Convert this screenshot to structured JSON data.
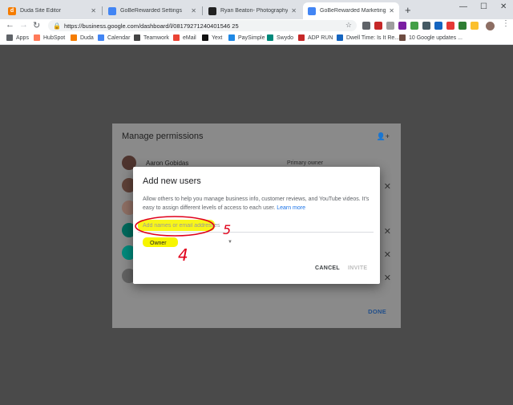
{
  "browser": {
    "tabs": [
      {
        "title": "Duda Site Editor",
        "color": "#f57c00",
        "active": false
      },
      {
        "title": "GoBeRewarded Settings",
        "color": "#4285f4",
        "active": false
      },
      {
        "title": "Ryan Beaton- Photography - Tai",
        "color": "#222222",
        "active": false
      },
      {
        "title": "GoBeRewarded Marketing Agenc",
        "color": "#4285f4",
        "active": true
      }
    ],
    "url": "https://business.google.com/dashboard/l/08179271240401546 25"
  },
  "bookmarks": [
    {
      "label": "Apps",
      "color": "#5f6368"
    },
    {
      "label": "HubSpot",
      "color": "#ff7a59"
    },
    {
      "label": "Duda",
      "color": "#f57c00"
    },
    {
      "label": "Calendar",
      "color": "#4285f4"
    },
    {
      "label": "Teamwork",
      "color": "#444444"
    },
    {
      "label": "eMail",
      "color": "#ea4335"
    },
    {
      "label": "Yext",
      "color": "#111111"
    },
    {
      "label": "PaySimple",
      "color": "#1e88e5"
    },
    {
      "label": "Swydo",
      "color": "#00897b"
    },
    {
      "label": "ADP RUN",
      "color": "#c62828"
    },
    {
      "label": "Dwell Time: Is It Re...",
      "color": "#1565c0"
    },
    {
      "label": "10 Google updates ...",
      "color": "#6d4c41"
    }
  ],
  "permissions": {
    "title": "Manage permissions",
    "owner_name": "Aaron Gobidas",
    "owner_role": "Primary owner",
    "done_label": "DONE"
  },
  "dialog": {
    "title": "Add new users",
    "description": "Allow others to help you manage business info, customer reviews, and YouTube videos. It's easy to assign different levels of access to each user.",
    "learn_more": "Learn more",
    "input_placeholder": "Add names or email addresses",
    "role_value": "Owner",
    "cancel_label": "CANCEL",
    "invite_label": "INVITE"
  },
  "annotations": {
    "mark_1": "5",
    "mark_2": "4"
  }
}
